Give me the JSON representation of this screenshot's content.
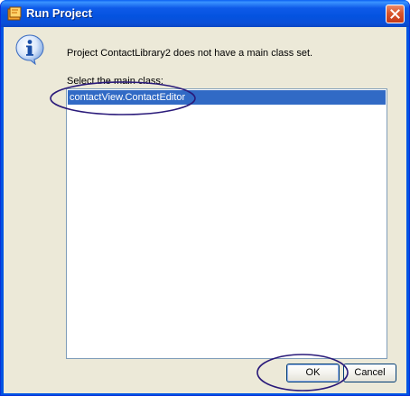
{
  "window": {
    "title": "Run Project"
  },
  "dialog": {
    "message": "Project ContactLibrary2 does not have a main class set.",
    "select_label": "Select the main class:",
    "classes": [
      "contactView.ContactEditor"
    ],
    "selected_index": 0
  },
  "buttons": {
    "ok_label": "OK",
    "cancel_label": "Cancel"
  },
  "icons": {
    "title": "app-icon",
    "close": "close-icon",
    "message": "info-icon"
  },
  "colors": {
    "titlebar": "#0054e3",
    "selection": "#316ac5",
    "annotation": "#2a1a7a",
    "dialog_bg": "#ece9d8"
  }
}
